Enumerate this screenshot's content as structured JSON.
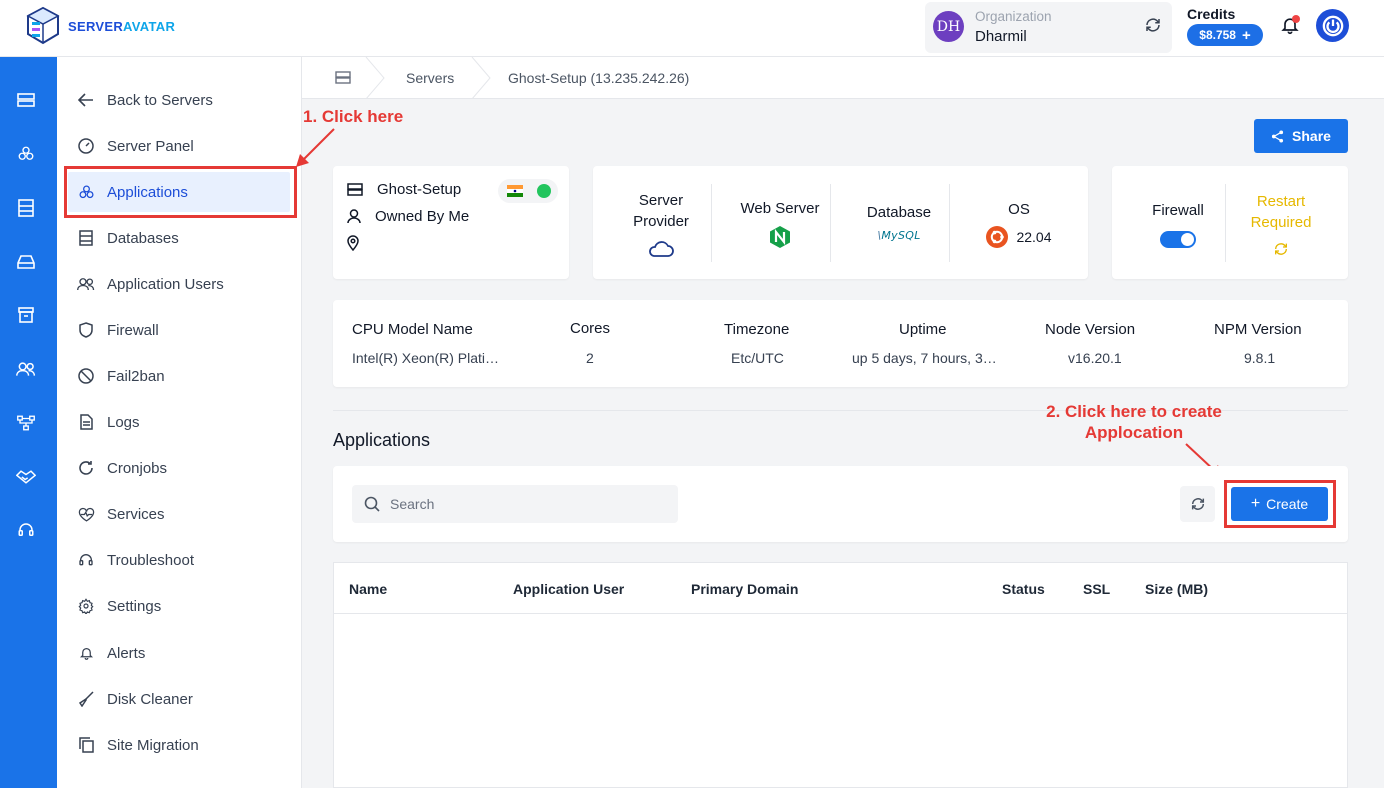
{
  "brand": {
    "part1": "SERVER",
    "part2": "AVATAR"
  },
  "org": {
    "initials": "DH",
    "label": "Organization",
    "name": "Dharmil"
  },
  "credits": {
    "label": "Credits",
    "amount": "$8.758"
  },
  "sidebar": {
    "items": [
      {
        "label": "Back to Servers",
        "icon": "arrow-left-icon"
      },
      {
        "label": "Server Panel",
        "icon": "gauge-icon"
      },
      {
        "label": "Applications",
        "icon": "apps-icon"
      },
      {
        "label": "Databases",
        "icon": "database-icon"
      },
      {
        "label": "Application Users",
        "icon": "users-icon"
      },
      {
        "label": "Firewall",
        "icon": "shield-icon"
      },
      {
        "label": "Fail2ban",
        "icon": "ban-icon"
      },
      {
        "label": "Logs",
        "icon": "file-icon"
      },
      {
        "label": "Cronjobs",
        "icon": "cron-icon"
      },
      {
        "label": "Services",
        "icon": "heartbeat-icon"
      },
      {
        "label": "Troubleshoot",
        "icon": "headset-icon"
      },
      {
        "label": "Settings",
        "icon": "gear-icon"
      },
      {
        "label": "Alerts",
        "icon": "bell-icon"
      },
      {
        "label": "Disk Cleaner",
        "icon": "broom-icon"
      },
      {
        "label": "Site Migration",
        "icon": "copy-icon"
      }
    ]
  },
  "breadcrumb": {
    "servers": "Servers",
    "current": "Ghost-Setup (13.235.242.26)"
  },
  "annotations": {
    "step1": "1. Click here",
    "step2_line1": "2. Click here to create",
    "step2_line2": "Applocation"
  },
  "share": {
    "label": "Share"
  },
  "server": {
    "name": "Ghost-Setup",
    "owner": "Owned By Me"
  },
  "stack": {
    "provider_label": "Server Provider",
    "webserver_label": "Web Server",
    "database_label": "Database",
    "database_logo": "MySQL",
    "os_label": "OS",
    "os_version": "22.04"
  },
  "firewall": {
    "label": "Firewall",
    "restart_label": "Restart Required"
  },
  "specs": {
    "cpu_label": "CPU Model Name",
    "cpu_value": "Intel(R) Xeon(R) Plati…",
    "cores_label": "Cores",
    "cores_value": "2",
    "tz_label": "Timezone",
    "tz_value": "Etc/UTC",
    "uptime_label": "Uptime",
    "uptime_value": "up 5 days, 7 hours, 3…",
    "node_label": "Node Version",
    "node_value": "v16.20.1",
    "npm_label": "NPM Version",
    "npm_value": "9.8.1"
  },
  "apps": {
    "title": "Applications",
    "search_placeholder": "Search",
    "create_label": "Create",
    "columns": [
      "Name",
      "Application User",
      "Primary Domain",
      "Status",
      "SSL",
      "Size (MB)"
    ]
  },
  "colors": {
    "primary": "#1a73e8",
    "annotation": "#e53935",
    "warning": "#e6b800",
    "online": "#22c55e"
  }
}
